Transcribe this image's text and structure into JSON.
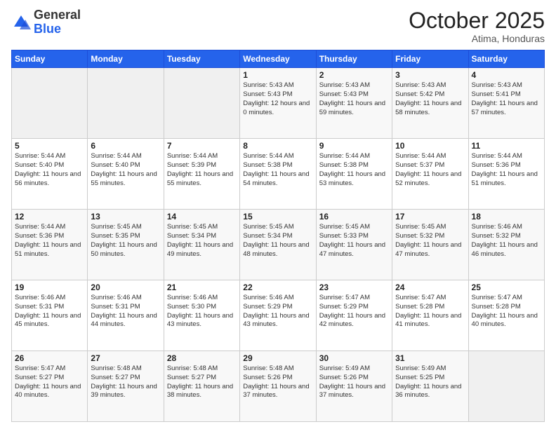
{
  "header": {
    "logo_general": "General",
    "logo_blue": "Blue",
    "month_title": "October 2025",
    "subtitle": "Atima, Honduras"
  },
  "weekdays": [
    "Sunday",
    "Monday",
    "Tuesday",
    "Wednesday",
    "Thursday",
    "Friday",
    "Saturday"
  ],
  "weeks": [
    [
      {
        "day": "",
        "empty": true
      },
      {
        "day": "",
        "empty": true
      },
      {
        "day": "",
        "empty": true
      },
      {
        "day": "1",
        "sunrise": "Sunrise: 5:43 AM",
        "sunset": "Sunset: 5:43 PM",
        "daylight": "Daylight: 12 hours and 0 minutes."
      },
      {
        "day": "2",
        "sunrise": "Sunrise: 5:43 AM",
        "sunset": "Sunset: 5:43 PM",
        "daylight": "Daylight: 11 hours and 59 minutes."
      },
      {
        "day": "3",
        "sunrise": "Sunrise: 5:43 AM",
        "sunset": "Sunset: 5:42 PM",
        "daylight": "Daylight: 11 hours and 58 minutes."
      },
      {
        "day": "4",
        "sunrise": "Sunrise: 5:43 AM",
        "sunset": "Sunset: 5:41 PM",
        "daylight": "Daylight: 11 hours and 57 minutes."
      }
    ],
    [
      {
        "day": "5",
        "sunrise": "Sunrise: 5:44 AM",
        "sunset": "Sunset: 5:40 PM",
        "daylight": "Daylight: 11 hours and 56 minutes."
      },
      {
        "day": "6",
        "sunrise": "Sunrise: 5:44 AM",
        "sunset": "Sunset: 5:40 PM",
        "daylight": "Daylight: 11 hours and 55 minutes."
      },
      {
        "day": "7",
        "sunrise": "Sunrise: 5:44 AM",
        "sunset": "Sunset: 5:39 PM",
        "daylight": "Daylight: 11 hours and 55 minutes."
      },
      {
        "day": "8",
        "sunrise": "Sunrise: 5:44 AM",
        "sunset": "Sunset: 5:38 PM",
        "daylight": "Daylight: 11 hours and 54 minutes."
      },
      {
        "day": "9",
        "sunrise": "Sunrise: 5:44 AM",
        "sunset": "Sunset: 5:38 PM",
        "daylight": "Daylight: 11 hours and 53 minutes."
      },
      {
        "day": "10",
        "sunrise": "Sunrise: 5:44 AM",
        "sunset": "Sunset: 5:37 PM",
        "daylight": "Daylight: 11 hours and 52 minutes."
      },
      {
        "day": "11",
        "sunrise": "Sunrise: 5:44 AM",
        "sunset": "Sunset: 5:36 PM",
        "daylight": "Daylight: 11 hours and 51 minutes."
      }
    ],
    [
      {
        "day": "12",
        "sunrise": "Sunrise: 5:44 AM",
        "sunset": "Sunset: 5:36 PM",
        "daylight": "Daylight: 11 hours and 51 minutes."
      },
      {
        "day": "13",
        "sunrise": "Sunrise: 5:45 AM",
        "sunset": "Sunset: 5:35 PM",
        "daylight": "Daylight: 11 hours and 50 minutes."
      },
      {
        "day": "14",
        "sunrise": "Sunrise: 5:45 AM",
        "sunset": "Sunset: 5:34 PM",
        "daylight": "Daylight: 11 hours and 49 minutes."
      },
      {
        "day": "15",
        "sunrise": "Sunrise: 5:45 AM",
        "sunset": "Sunset: 5:34 PM",
        "daylight": "Daylight: 11 hours and 48 minutes."
      },
      {
        "day": "16",
        "sunrise": "Sunrise: 5:45 AM",
        "sunset": "Sunset: 5:33 PM",
        "daylight": "Daylight: 11 hours and 47 minutes."
      },
      {
        "day": "17",
        "sunrise": "Sunrise: 5:45 AM",
        "sunset": "Sunset: 5:32 PM",
        "daylight": "Daylight: 11 hours and 47 minutes."
      },
      {
        "day": "18",
        "sunrise": "Sunrise: 5:46 AM",
        "sunset": "Sunset: 5:32 PM",
        "daylight": "Daylight: 11 hours and 46 minutes."
      }
    ],
    [
      {
        "day": "19",
        "sunrise": "Sunrise: 5:46 AM",
        "sunset": "Sunset: 5:31 PM",
        "daylight": "Daylight: 11 hours and 45 minutes."
      },
      {
        "day": "20",
        "sunrise": "Sunrise: 5:46 AM",
        "sunset": "Sunset: 5:31 PM",
        "daylight": "Daylight: 11 hours and 44 minutes."
      },
      {
        "day": "21",
        "sunrise": "Sunrise: 5:46 AM",
        "sunset": "Sunset: 5:30 PM",
        "daylight": "Daylight: 11 hours and 43 minutes."
      },
      {
        "day": "22",
        "sunrise": "Sunrise: 5:46 AM",
        "sunset": "Sunset: 5:29 PM",
        "daylight": "Daylight: 11 hours and 43 minutes."
      },
      {
        "day": "23",
        "sunrise": "Sunrise: 5:47 AM",
        "sunset": "Sunset: 5:29 PM",
        "daylight": "Daylight: 11 hours and 42 minutes."
      },
      {
        "day": "24",
        "sunrise": "Sunrise: 5:47 AM",
        "sunset": "Sunset: 5:28 PM",
        "daylight": "Daylight: 11 hours and 41 minutes."
      },
      {
        "day": "25",
        "sunrise": "Sunrise: 5:47 AM",
        "sunset": "Sunset: 5:28 PM",
        "daylight": "Daylight: 11 hours and 40 minutes."
      }
    ],
    [
      {
        "day": "26",
        "sunrise": "Sunrise: 5:47 AM",
        "sunset": "Sunset: 5:27 PM",
        "daylight": "Daylight: 11 hours and 40 minutes."
      },
      {
        "day": "27",
        "sunrise": "Sunrise: 5:48 AM",
        "sunset": "Sunset: 5:27 PM",
        "daylight": "Daylight: 11 hours and 39 minutes."
      },
      {
        "day": "28",
        "sunrise": "Sunrise: 5:48 AM",
        "sunset": "Sunset: 5:27 PM",
        "daylight": "Daylight: 11 hours and 38 minutes."
      },
      {
        "day": "29",
        "sunrise": "Sunrise: 5:48 AM",
        "sunset": "Sunset: 5:26 PM",
        "daylight": "Daylight: 11 hours and 37 minutes."
      },
      {
        "day": "30",
        "sunrise": "Sunrise: 5:49 AM",
        "sunset": "Sunset: 5:26 PM",
        "daylight": "Daylight: 11 hours and 37 minutes."
      },
      {
        "day": "31",
        "sunrise": "Sunrise: 5:49 AM",
        "sunset": "Sunset: 5:25 PM",
        "daylight": "Daylight: 11 hours and 36 minutes."
      },
      {
        "day": "",
        "empty": true
      }
    ]
  ]
}
